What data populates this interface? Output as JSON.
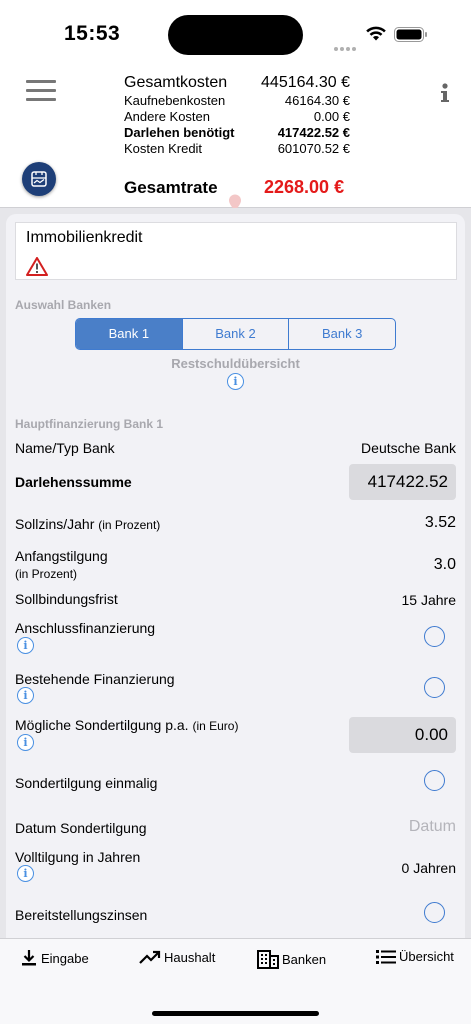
{
  "status": {
    "time": "15:53"
  },
  "header": {
    "rows": [
      {
        "label": "Gesamtkosten",
        "value": "445164.30 €"
      },
      {
        "label": "Kaufnebenkosten",
        "value": "46164.30 €"
      },
      {
        "label": "Andere Kosten",
        "value": "0.00 €"
      },
      {
        "label": "Darlehen benötigt",
        "value": "417422.52 €"
      },
      {
        "label": "Kosten Kredit",
        "value": "601070.52 €"
      }
    ],
    "rate_label": "Gesamtrate",
    "rate_value": "2268.00 €",
    "rate_color": "#e41a1a"
  },
  "card": {
    "title": "Immobilienkredit"
  },
  "bank_selection": {
    "heading": "Auswahl Banken",
    "tabs": [
      "Bank 1",
      "Bank 2",
      "Bank 3"
    ],
    "selected": "Bank 1",
    "rest_label": "Restschuldübersicht"
  },
  "form": {
    "heading": "Hauptfinanzierung Bank 1",
    "name_label": "Name/Typ Bank",
    "name_value": "Deutsche Bank",
    "amount_label": "Darlehenssumme",
    "amount_value": "417422.52",
    "interest_label": "Sollzins/Jahr",
    "interest_unit": "(in Prozent)",
    "interest_value": "3.52",
    "repay_label": "Anfangstilgung",
    "repay_unit": "(in Prozent)",
    "repay_value": "3.0",
    "fixed_label": "Sollbindungsfrist",
    "fixed_value": "15 Jahre",
    "follow_label": "Anschlussfinanzierung",
    "existing_label": "Bestehende Finanzierung",
    "special_label": "Mögliche Sondertilgung p.a.",
    "special_unit": "(in Euro)",
    "special_value": "0.00",
    "once_label": "Sondertilgung einmalig",
    "date_label": "Datum Sondertilgung",
    "date_placeholder": "Datum",
    "full_label": "Volltilgung in Jahren",
    "full_value": "0 Jahren",
    "provision_label": "Bereitstellungszinsen"
  },
  "tabbar": {
    "tabs": [
      "Eingabe",
      "Haushalt",
      "Banken",
      "Übersicht"
    ]
  },
  "colors": {
    "accent": "#3f7bd0",
    "brand_dark": "#1e3f78",
    "red": "#e41a1a"
  }
}
